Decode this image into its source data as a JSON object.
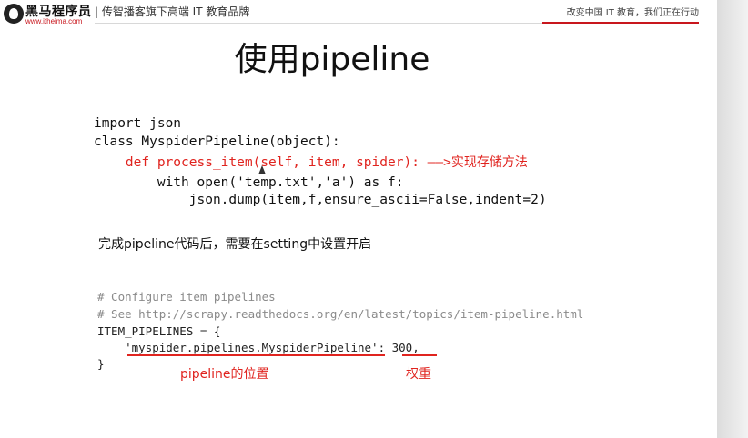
{
  "header": {
    "brand_name": "黑马程序员",
    "brand_url": "www.itheima.com",
    "slogan": "| 传智播客旗下高端 IT 教育品牌",
    "right_text": "改变中国 IT 教育，我们正在行动"
  },
  "slide": {
    "title": "使用pipeline",
    "code_lines": {
      "l1": "import json",
      "l2": "class MyspiderPipeline(object):",
      "l3": "    def process_item(self, item, spider): ——>",
      "l3_note": "实现存储方法",
      "l4": "        with open('temp.txt','a') as f:",
      "l5": "            json.dump(item,f,ensure_ascii=False,indent=2)"
    },
    "note": "完成pipeline代码后，需要在setting中设置开启",
    "config_lines": {
      "c1": "# Configure item pipelines",
      "c2": "# See http://scrapy.readthedocs.org/en/latest/topics/item-pipeline.html",
      "c3": "ITEM_PIPELINES = {",
      "c4_key": "    'myspider.pipelines.MyspiderPipeline'",
      "c4_sep": ": ",
      "c4_val": "300,",
      "c5": "}"
    },
    "label_position": "pipeline的位置",
    "label_weight": "权重"
  },
  "colors": {
    "accent_red": "#e0241f",
    "brand_red": "#c8161d"
  }
}
